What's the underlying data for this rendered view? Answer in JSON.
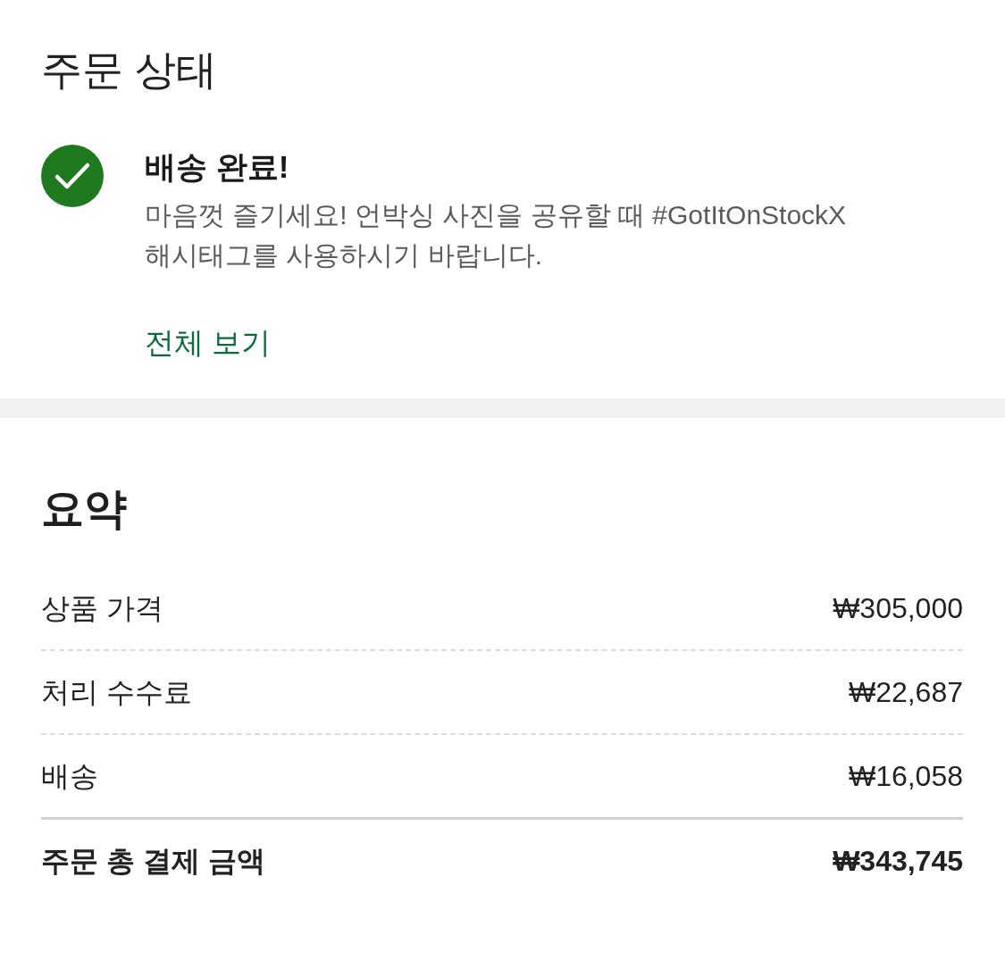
{
  "order_status": {
    "title": "주문 상태",
    "status_title": "배송 완료!",
    "message": "마음껏 즐기세요! 언박싱 사진을 공유할 때 #GotItOnStockX 해시태그를 사용하시기 바랍니다.",
    "link": "전체 보기"
  },
  "summary": {
    "title": "요약",
    "rows": [
      {
        "kind": "line",
        "label": "상품 가격",
        "value": "₩305,000"
      },
      {
        "kind": "line",
        "label": "처리 수수료",
        "value": "₩22,687"
      },
      {
        "kind": "line",
        "label": "배송",
        "value": "₩16,058"
      },
      {
        "kind": "total",
        "label": "주문 총 결제 금액",
        "value": "₩343,745"
      }
    ]
  }
}
